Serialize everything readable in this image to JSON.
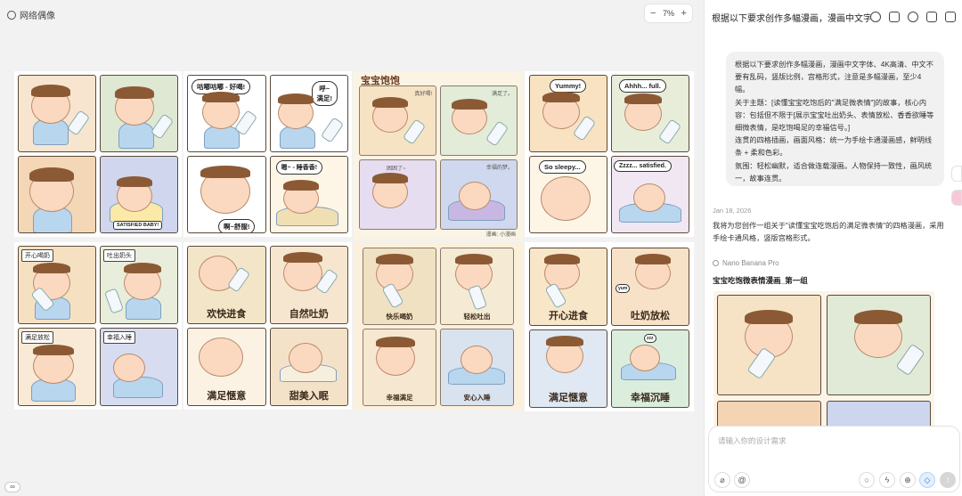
{
  "canvas": {
    "file_label": "网络偶像",
    "zoom": "7%",
    "zoom_minus": "−",
    "zoom_plus": "+"
  },
  "sheets": {
    "s1": {
      "badge": "SATISFIED BABY!"
    },
    "s2": {
      "b1": "咕嘟咕嘟 - 好喝!",
      "b2": "呼~\n满足!",
      "b3": "嗯~ - 睡香香!",
      "b4": "啊~舒服!"
    },
    "s3": {
      "title": "宝宝饱饱",
      "c1": "真好喝!",
      "c2": "满足了。",
      "c3": "困困了~",
      "c4": "幸福的梦。",
      "credit": "漫画: 小漫画"
    },
    "s4": {
      "b1": "Yummy!",
      "b2": "Ahhh... full.",
      "b3": "So sleepy...",
      "b4": "Zzzz... satisfied."
    },
    "s5": {
      "t1": "开心喝奶",
      "t2": "吐出奶头",
      "t3": "满足放松",
      "t4": "幸福入睡"
    },
    "s6": {
      "c1": "欢快进食",
      "c2": "自然吐奶",
      "c3": "满足惬意",
      "c4": "甜美入眠"
    },
    "s7": {
      "c1": "快乐喝奶",
      "c2": "轻松吐出",
      "c3": "幸福满足",
      "c4": "安心入睡"
    },
    "s8": {
      "c1": "开心进食",
      "c2": "吐奶放松",
      "c3": "满足惬意",
      "c4": "幸福沉睡",
      "b1": "yum",
      "b2": "zzz"
    }
  },
  "sidebar": {
    "title": "根据以下要求创作多幅漫画，漫画中文字...",
    "prompt": "根据以下要求创作多幅漫画，漫画中文字体、4K高清、中文不要有乱码，竖版比例，宫格形式，注意是多幅漫画，至少4幅。\n关于主题：[读懂宝宝吃饱后的\"满足微表情\"]的故事，核心内容：包括但不限于[展示宝宝吐出奶头、表情放松、香香欲睡等细微表情，是吃饱喝足的幸福信号。]\n连贯的四格插画，画面风格：统一为手绘卡通漫画感，鲜明线条 + 柔和色彩。\n氛围：轻松幽默，适合做连载漫画。人物保持一致性，画风统一，故事连贯。",
    "date": "Jan 18, 2026",
    "reply": "我将为您创作一组关于\"读懂宝宝吃饱后的满足微表情\"的四格漫画，采用手绘卡通风格，竖版宫格形式。",
    "model": "Nano Banana Pro",
    "group_title": "宝宝吃饱微表情漫画_第一组"
  },
  "input": {
    "placeholder": "请输入你的设计需求"
  },
  "colors": {
    "accent": "#2f6fd0",
    "panel_bg": "#f1f1f1"
  }
}
